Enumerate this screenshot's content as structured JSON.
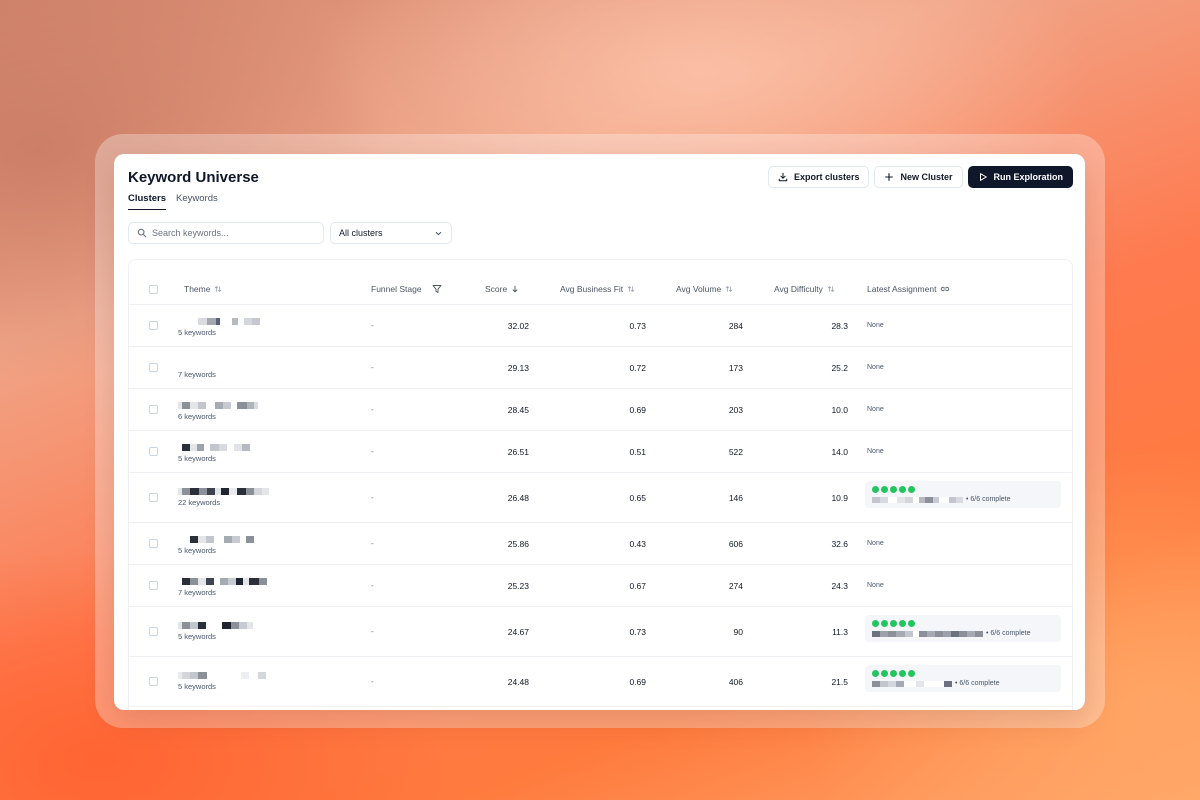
{
  "header": {
    "title": "Keyword Universe",
    "tabs": [
      {
        "label": "Clusters"
      },
      {
        "label": "Keywords"
      }
    ]
  },
  "actions": {
    "export_label": "Export clusters",
    "new_cluster_label": "New Cluster",
    "run_label": "Run Exploration"
  },
  "filters": {
    "search_placeholder": "Search keywords...",
    "search_value": "",
    "cluster_select": "All clusters"
  },
  "table": {
    "columns": [
      "Theme",
      "Funnel Stage",
      "Score",
      "Avg Business Fit",
      "Avg Volume",
      "Avg Difficulty",
      "Latest Assignment"
    ],
    "rows": [
      {
        "keywords": "5 keywords",
        "funnel": "-",
        "score": "32.02",
        "fit": "0.73",
        "volume": "284",
        "difficulty": "28.3",
        "assignment": "None"
      },
      {
        "keywords": "7 keywords",
        "funnel": "-",
        "score": "29.13",
        "fit": "0.72",
        "volume": "173",
        "difficulty": "25.2",
        "assignment": "None"
      },
      {
        "keywords": "6 keywords",
        "funnel": "-",
        "score": "28.45",
        "fit": "0.69",
        "volume": "203",
        "difficulty": "10.0",
        "assignment": "None"
      },
      {
        "keywords": "5 keywords",
        "funnel": "-",
        "score": "26.51",
        "fit": "0.51",
        "volume": "522",
        "difficulty": "14.0",
        "assignment": "None"
      },
      {
        "keywords": "22 keywords",
        "funnel": "-",
        "score": "26.48",
        "fit": "0.65",
        "volume": "146",
        "difficulty": "10.9",
        "assignment": "• 6/6 complete"
      },
      {
        "keywords": "5 keywords",
        "funnel": "-",
        "score": "25.86",
        "fit": "0.43",
        "volume": "606",
        "difficulty": "32.6",
        "assignment": "None"
      },
      {
        "keywords": "7 keywords",
        "funnel": "-",
        "score": "25.23",
        "fit": "0.67",
        "volume": "274",
        "difficulty": "24.3",
        "assignment": "None"
      },
      {
        "keywords": "5 keywords",
        "funnel": "-",
        "score": "24.67",
        "fit": "0.73",
        "volume": "90",
        "difficulty": "11.3",
        "assignment": "• 6/6 complete"
      },
      {
        "keywords": "5 keywords",
        "funnel": "-",
        "score": "24.48",
        "fit": "0.69",
        "volume": "406",
        "difficulty": "21.5",
        "assignment": "• 6/6 complete"
      }
    ]
  },
  "colors": {
    "primary": "#0f172a",
    "progress": "#22c55e"
  }
}
